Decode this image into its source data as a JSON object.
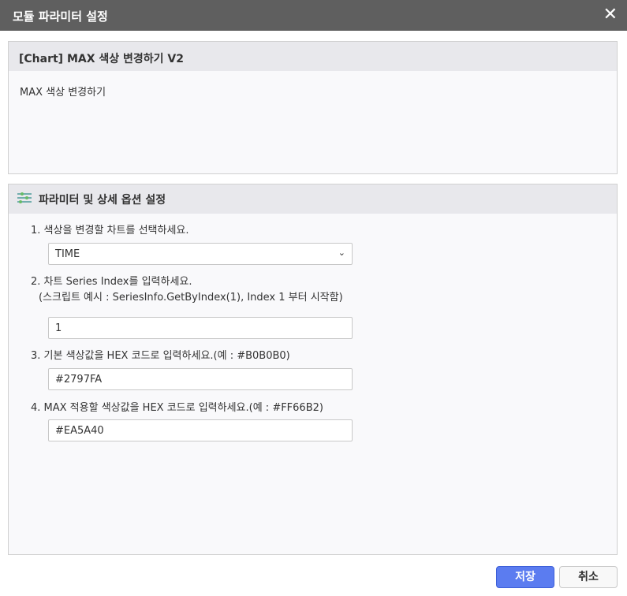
{
  "dialog": {
    "title": "모듈 파라미터 설정",
    "close_icon": "close-icon"
  },
  "module": {
    "name": "[Chart] MAX 색상 변경하기 V2",
    "description": "MAX 색상 변경하기"
  },
  "params": {
    "header": "파라미터 및 상세 옵션 설정",
    "items": [
      {
        "label": "1. 색상을 변경할 차트를 선택하세요.",
        "value": "TIME"
      },
      {
        "label": "2. 차트  Series Index를 입력하세요.",
        "sublabel": "(스크립트 예시 : SeriesInfo.GetByIndex(1), Index 1 부터 시작함)",
        "value": "1"
      },
      {
        "label": "3. 기본 색상값을 HEX 코드로 입력하세요.(예 : #B0B0B0)",
        "value": "#2797FA"
      },
      {
        "label": "4. MAX 적용할 색상값을 HEX 코드로 입력하세요.(예 : #FF66B2)",
        "value": "#EA5A40"
      }
    ]
  },
  "buttons": {
    "save": "저장",
    "cancel": "취소"
  }
}
